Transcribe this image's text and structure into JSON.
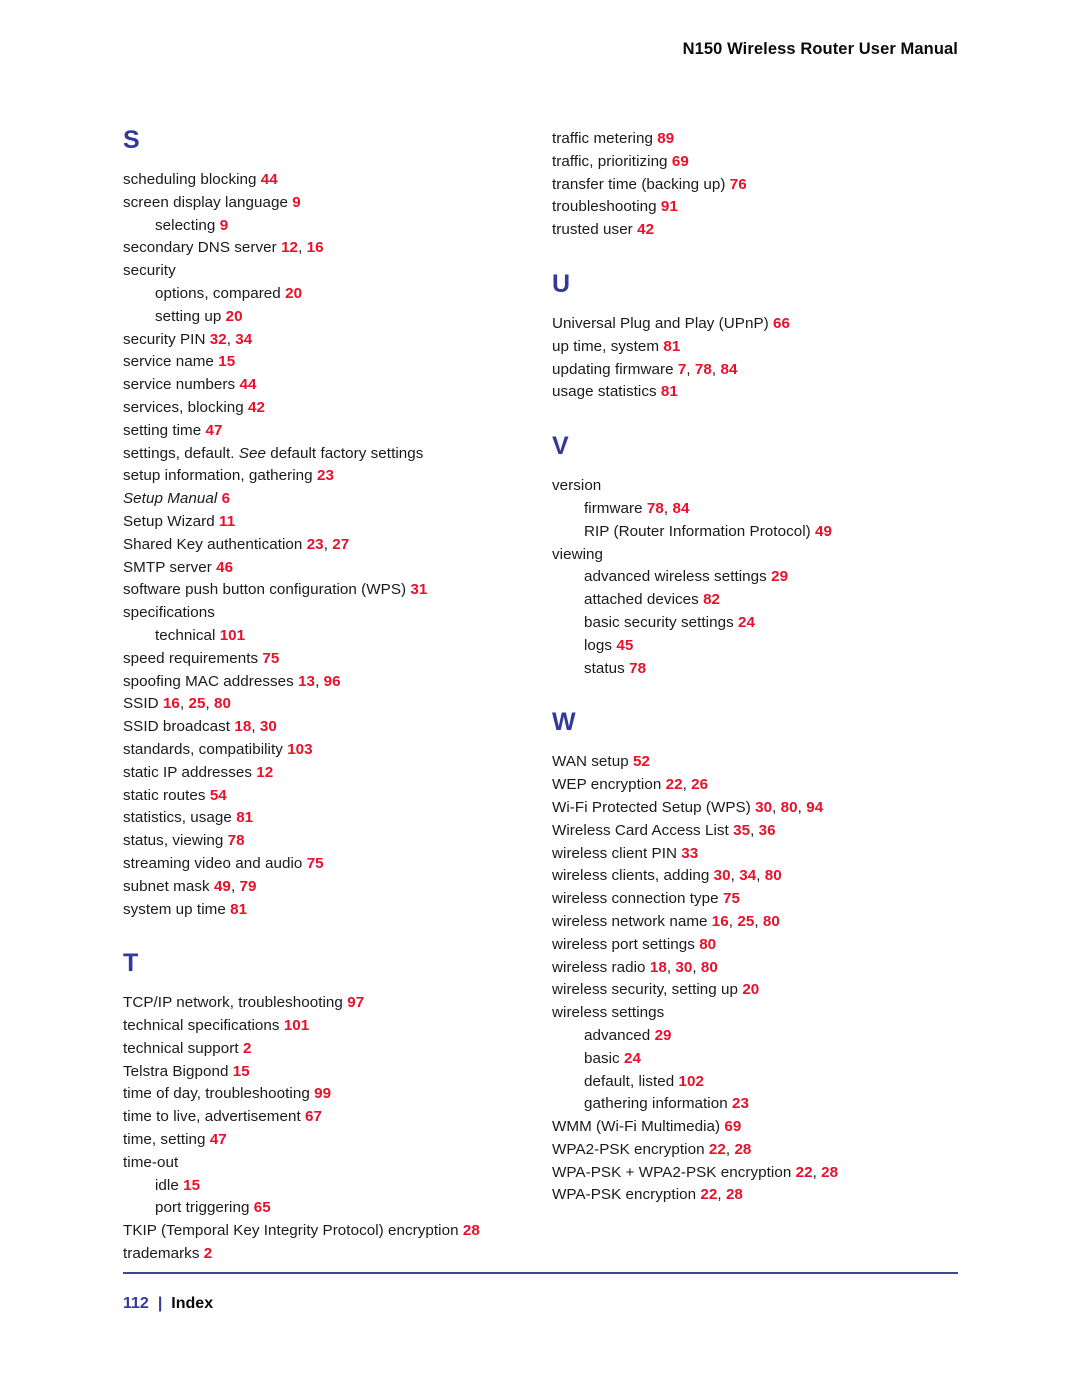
{
  "header": {
    "title": "N150 Wireless Router User Manual"
  },
  "footer": {
    "page_number": "112",
    "separator": "|",
    "label": "Index",
    "rule_color": "#3b4a93"
  },
  "colors": {
    "section_letter": "#33399b",
    "page_ref": "#e8102a",
    "body_text": "#1a1a1a",
    "header_text": "#0a0a0a"
  },
  "columns": [
    {
      "name": "left-column",
      "sections": [
        {
          "letter": "S",
          "entries": [
            {
              "level": 1,
              "term": "scheduling blocking",
              "pages": [
                "44"
              ]
            },
            {
              "level": 1,
              "term": "screen display language",
              "pages": [
                "9"
              ]
            },
            {
              "level": 2,
              "term": "selecting",
              "pages": [
                "9"
              ]
            },
            {
              "level": 1,
              "term": "secondary DNS server",
              "pages": [
                "12",
                "16"
              ]
            },
            {
              "level": 1,
              "term": "security",
              "pages": []
            },
            {
              "level": 2,
              "term": "options, compared",
              "pages": [
                "20"
              ]
            },
            {
              "level": 2,
              "term": "setting up",
              "pages": [
                "20"
              ]
            },
            {
              "level": 1,
              "term": "security PIN",
              "pages": [
                "32",
                "34"
              ]
            },
            {
              "level": 1,
              "term": "service name",
              "pages": [
                "15"
              ]
            },
            {
              "level": 1,
              "term": "service numbers",
              "pages": [
                "44"
              ]
            },
            {
              "level": 1,
              "term": "services, blocking",
              "pages": [
                "42"
              ]
            },
            {
              "level": 1,
              "term": "setting time",
              "pages": [
                "47"
              ]
            },
            {
              "level": 1,
              "term": "settings, default. See default factory settings",
              "pages": [],
              "italic_part": "See"
            },
            {
              "level": 1,
              "term": "setup information, gathering",
              "pages": [
                "23"
              ]
            },
            {
              "level": 1,
              "term": "Setup Manual",
              "pages": [
                "6"
              ],
              "italic": true
            },
            {
              "level": 1,
              "term": "Setup Wizard",
              "pages": [
                "11"
              ]
            },
            {
              "level": 1,
              "term": "Shared Key authentication",
              "pages": [
                "23",
                "27"
              ]
            },
            {
              "level": 1,
              "term": "SMTP server",
              "pages": [
                "46"
              ]
            },
            {
              "level": 1,
              "term": "software push button configuration (WPS)",
              "pages": [
                "31"
              ]
            },
            {
              "level": 1,
              "term": "specifications",
              "pages": []
            },
            {
              "level": 2,
              "term": "technical",
              "pages": [
                "101"
              ]
            },
            {
              "level": 1,
              "term": "speed requirements",
              "pages": [
                "75"
              ]
            },
            {
              "level": 1,
              "term": "spoofing MAC addresses",
              "pages": [
                "13",
                "96"
              ]
            },
            {
              "level": 1,
              "term": "SSID",
              "pages": [
                "16",
                "25",
                "80"
              ]
            },
            {
              "level": 1,
              "term": "SSID broadcast",
              "pages": [
                "18",
                "30"
              ]
            },
            {
              "level": 1,
              "term": "standards, compatibility",
              "pages": [
                "103"
              ]
            },
            {
              "level": 1,
              "term": "static IP addresses",
              "pages": [
                "12"
              ]
            },
            {
              "level": 1,
              "term": "static routes",
              "pages": [
                "54"
              ]
            },
            {
              "level": 1,
              "term": "statistics, usage",
              "pages": [
                "81"
              ]
            },
            {
              "level": 1,
              "term": "status, viewing",
              "pages": [
                "78"
              ]
            },
            {
              "level": 1,
              "term": "streaming video and audio",
              "pages": [
                "75"
              ]
            },
            {
              "level": 1,
              "term": "subnet mask",
              "pages": [
                "49",
                "79"
              ]
            },
            {
              "level": 1,
              "term": "system up time",
              "pages": [
                "81"
              ]
            }
          ]
        },
        {
          "letter": "T",
          "entries": [
            {
              "level": 1,
              "term": "TCP/IP network, troubleshooting",
              "pages": [
                "97"
              ]
            },
            {
              "level": 1,
              "term": "technical specifications",
              "pages": [
                "101"
              ]
            },
            {
              "level": 1,
              "term": "technical support",
              "pages": [
                "2"
              ]
            },
            {
              "level": 1,
              "term": "Telstra Bigpond",
              "pages": [
                "15"
              ]
            },
            {
              "level": 1,
              "term": "time of day, troubleshooting",
              "pages": [
                "99"
              ]
            },
            {
              "level": 1,
              "term": "time to live, advertisement",
              "pages": [
                "67"
              ]
            },
            {
              "level": 1,
              "term": "time, setting",
              "pages": [
                "47"
              ]
            },
            {
              "level": 1,
              "term": "time-out",
              "pages": []
            },
            {
              "level": 2,
              "term": "idle",
              "pages": [
                "15"
              ]
            },
            {
              "level": 2,
              "term": "port triggering",
              "pages": [
                "65"
              ]
            },
            {
              "level": 1,
              "term": "TKIP (Temporal Key Integrity Protocol) encryption",
              "pages": [
                "28"
              ]
            },
            {
              "level": 1,
              "term": "trademarks",
              "pages": [
                "2"
              ]
            }
          ]
        }
      ]
    },
    {
      "name": "right-column",
      "sections": [
        {
          "letter": "",
          "entries": [
            {
              "level": 1,
              "term": "traffic metering",
              "pages": [
                "89"
              ]
            },
            {
              "level": 1,
              "term": "traffic, prioritizing",
              "pages": [
                "69"
              ]
            },
            {
              "level": 1,
              "term": "transfer time (backing up)",
              "pages": [
                "76"
              ]
            },
            {
              "level": 1,
              "term": "troubleshooting",
              "pages": [
                "91"
              ]
            },
            {
              "level": 1,
              "term": "trusted user",
              "pages": [
                "42"
              ]
            }
          ]
        },
        {
          "letter": "U",
          "entries": [
            {
              "level": 1,
              "term": "Universal Plug and Play (UPnP)",
              "pages": [
                "66"
              ]
            },
            {
              "level": 1,
              "term": "up time, system",
              "pages": [
                "81"
              ]
            },
            {
              "level": 1,
              "term": "updating firmware",
              "pages": [
                "7",
                "78",
                "84"
              ]
            },
            {
              "level": 1,
              "term": "usage statistics",
              "pages": [
                "81"
              ]
            }
          ]
        },
        {
          "letter": "V",
          "entries": [
            {
              "level": 1,
              "term": "version",
              "pages": []
            },
            {
              "level": 2,
              "term": "firmware",
              "pages": [
                "78",
                "84"
              ]
            },
            {
              "level": 2,
              "term": "RIP (Router Information Protocol)",
              "pages": [
                "49"
              ]
            },
            {
              "level": 1,
              "term": "viewing",
              "pages": []
            },
            {
              "level": 2,
              "term": "advanced wireless settings",
              "pages": [
                "29"
              ]
            },
            {
              "level": 2,
              "term": "attached devices",
              "pages": [
                "82"
              ]
            },
            {
              "level": 2,
              "term": "basic security settings",
              "pages": [
                "24"
              ]
            },
            {
              "level": 2,
              "term": "logs",
              "pages": [
                "45"
              ]
            },
            {
              "level": 2,
              "term": "status",
              "pages": [
                "78"
              ]
            }
          ]
        },
        {
          "letter": "W",
          "entries": [
            {
              "level": 1,
              "term": "WAN setup",
              "pages": [
                "52"
              ]
            },
            {
              "level": 1,
              "term": "WEP encryption",
              "pages": [
                "22",
                "26"
              ]
            },
            {
              "level": 1,
              "term": "Wi-Fi Protected Setup (WPS)",
              "pages": [
                "30",
                "80",
                "94"
              ]
            },
            {
              "level": 1,
              "term": "Wireless Card Access List",
              "pages": [
                "35",
                "36"
              ]
            },
            {
              "level": 1,
              "term": "wireless client PIN",
              "pages": [
                "33"
              ]
            },
            {
              "level": 1,
              "term": "wireless clients, adding",
              "pages": [
                "30",
                "34",
                "80"
              ]
            },
            {
              "level": 1,
              "term": "wireless connection type",
              "pages": [
                "75"
              ]
            },
            {
              "level": 1,
              "term": "wireless network name",
              "pages": [
                "16",
                "25",
                "80"
              ]
            },
            {
              "level": 1,
              "term": "wireless port settings",
              "pages": [
                "80"
              ]
            },
            {
              "level": 1,
              "term": "wireless radio",
              "pages": [
                "18",
                "30",
                "80"
              ]
            },
            {
              "level": 1,
              "term": "wireless security, setting up",
              "pages": [
                "20"
              ]
            },
            {
              "level": 1,
              "term": "wireless settings",
              "pages": []
            },
            {
              "level": 2,
              "term": "advanced",
              "pages": [
                "29"
              ]
            },
            {
              "level": 2,
              "term": "basic",
              "pages": [
                "24"
              ]
            },
            {
              "level": 2,
              "term": "default, listed",
              "pages": [
                "102"
              ]
            },
            {
              "level": 2,
              "term": "gathering information",
              "pages": [
                "23"
              ]
            },
            {
              "level": 1,
              "term": "WMM (Wi-Fi Multimedia)",
              "pages": [
                "69"
              ]
            },
            {
              "level": 1,
              "term": "WPA2-PSK encryption",
              "pages": [
                "22",
                "28"
              ]
            },
            {
              "level": 1,
              "term": "WPA-PSK + WPA2-PSK encryption",
              "pages": [
                "22",
                "28"
              ]
            },
            {
              "level": 1,
              "term": "WPA-PSK encryption",
              "pages": [
                "22",
                "28"
              ]
            }
          ]
        }
      ]
    }
  ]
}
